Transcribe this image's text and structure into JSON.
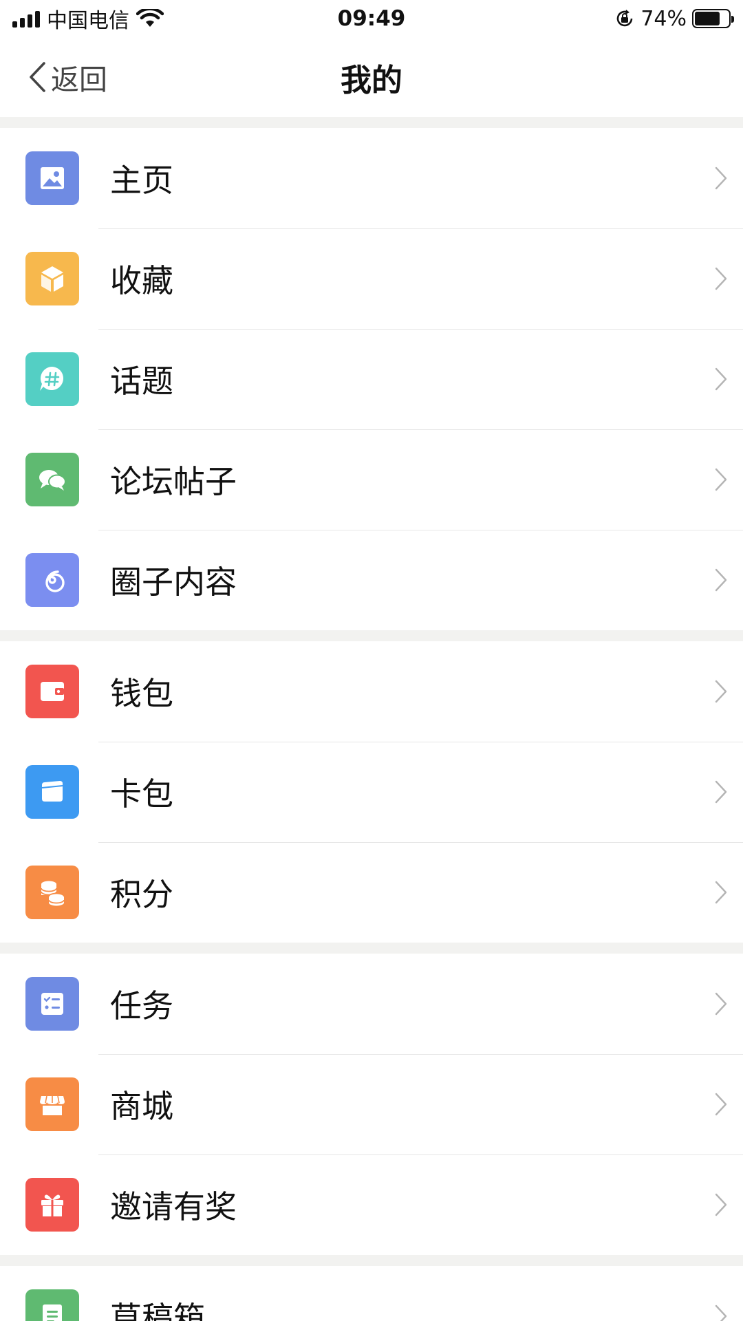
{
  "status_bar": {
    "carrier": "中国电信",
    "time": "09:49",
    "battery_percent": "74%",
    "battery_level": 0.74
  },
  "nav": {
    "back_label": "返回",
    "title": "我的"
  },
  "sections": [
    {
      "items": [
        {
          "id": "home",
          "label": "主页",
          "icon": "image-icon",
          "color": "#6f8be3"
        },
        {
          "id": "favorites",
          "label": "收藏",
          "icon": "cube-icon",
          "color": "#f7b84d"
        },
        {
          "id": "topics",
          "label": "话题",
          "icon": "hashtag-bubble-icon",
          "color": "#54cfc4"
        },
        {
          "id": "forum-posts",
          "label": "论坛帖子",
          "icon": "chat-bubbles-icon",
          "color": "#5fba71"
        },
        {
          "id": "circle-content",
          "label": "圈子内容",
          "icon": "spiral-icon",
          "color": "#7b8ef0"
        }
      ]
    },
    {
      "items": [
        {
          "id": "wallet",
          "label": "钱包",
          "icon": "wallet-icon",
          "color": "#f2554f"
        },
        {
          "id": "card-pack",
          "label": "卡包",
          "icon": "card-icon",
          "color": "#3d9af2"
        },
        {
          "id": "points",
          "label": "积分",
          "icon": "coins-icon",
          "color": "#f78c45"
        }
      ]
    },
    {
      "items": [
        {
          "id": "tasks",
          "label": "任务",
          "icon": "checklist-icon",
          "color": "#6f8be3"
        },
        {
          "id": "mall",
          "label": "商城",
          "icon": "store-icon",
          "color": "#f78c45"
        },
        {
          "id": "invite",
          "label": "邀请有奖",
          "icon": "gift-icon",
          "color": "#f2554f"
        }
      ]
    },
    {
      "items": [
        {
          "id": "drafts",
          "label": "草稿箱",
          "icon": "document-icon",
          "color": "#5fba71"
        }
      ]
    }
  ]
}
